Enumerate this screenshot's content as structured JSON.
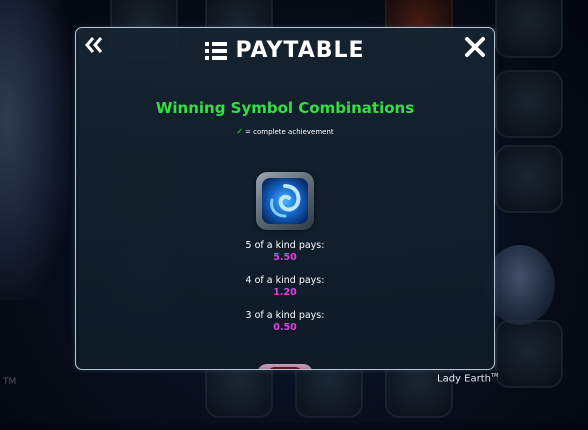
{
  "dialog": {
    "title": "PAYTABLE",
    "subtitle": "Winning Symbol Combinations",
    "legend_text": "= complete achievement",
    "legend_icon": "check-icon",
    "back_icon": "double-chevron-left-icon",
    "close_icon": "close-icon",
    "title_icon": "list-icon"
  },
  "symbol": {
    "icon": "blue-swirl-symbol-icon",
    "pays": [
      {
        "label": "5 of a kind pays:",
        "value": "5.50"
      },
      {
        "label": "4 of a kind pays:",
        "value": "1.20"
      },
      {
        "label": "3 of a kind pays:",
        "value": "0.50"
      }
    ]
  },
  "game": {
    "name": "Lady Earth",
    "trademark": "TM"
  },
  "colors": {
    "subtitle": "#33e044",
    "pay_value": "#e040e0",
    "dialog_border": "#b9c6d2"
  }
}
